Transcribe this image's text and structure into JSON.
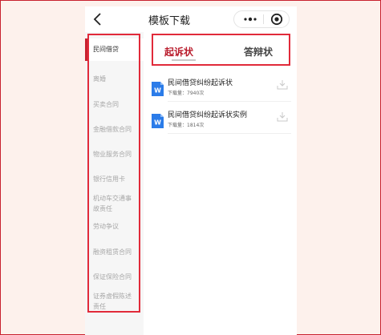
{
  "header": {
    "title": "模板下载",
    "back_icon": "chevron-left-icon",
    "more_icon": "more-dots-icon",
    "close_icon": "target-circle-icon"
  },
  "sidebar": {
    "items": [
      {
        "label": "民间借贷",
        "active": true
      },
      {
        "label": "离婚",
        "active": false
      },
      {
        "label": "买卖合同",
        "active": false
      },
      {
        "label": "金融借款合同",
        "active": false
      },
      {
        "label": "物业服务合同",
        "active": false
      },
      {
        "label": "银行信用卡",
        "active": false
      },
      {
        "label": "机动车交通事故责任",
        "active": false
      },
      {
        "label": "劳动争议",
        "active": false
      },
      {
        "label": "融资租赁合同",
        "active": false
      },
      {
        "label": "保证保险合同",
        "active": false
      },
      {
        "label": "证券虚假陈述责任",
        "active": false
      }
    ]
  },
  "tabs": [
    {
      "label": "起诉状",
      "active": true
    },
    {
      "label": "答辩状",
      "active": false
    }
  ],
  "documents": [
    {
      "title": "民间借贷纠纷起诉状",
      "downloads": "下载量：7940次",
      "icon": "word-doc-icon"
    },
    {
      "title": "民间借贷纠纷起诉状实例",
      "downloads": "下载量：1814次",
      "icon": "word-doc-icon"
    }
  ],
  "colors": {
    "accent": "#c8212f",
    "highlight_frame": "#e12a3a",
    "word_blue": "#2b7ce9"
  }
}
